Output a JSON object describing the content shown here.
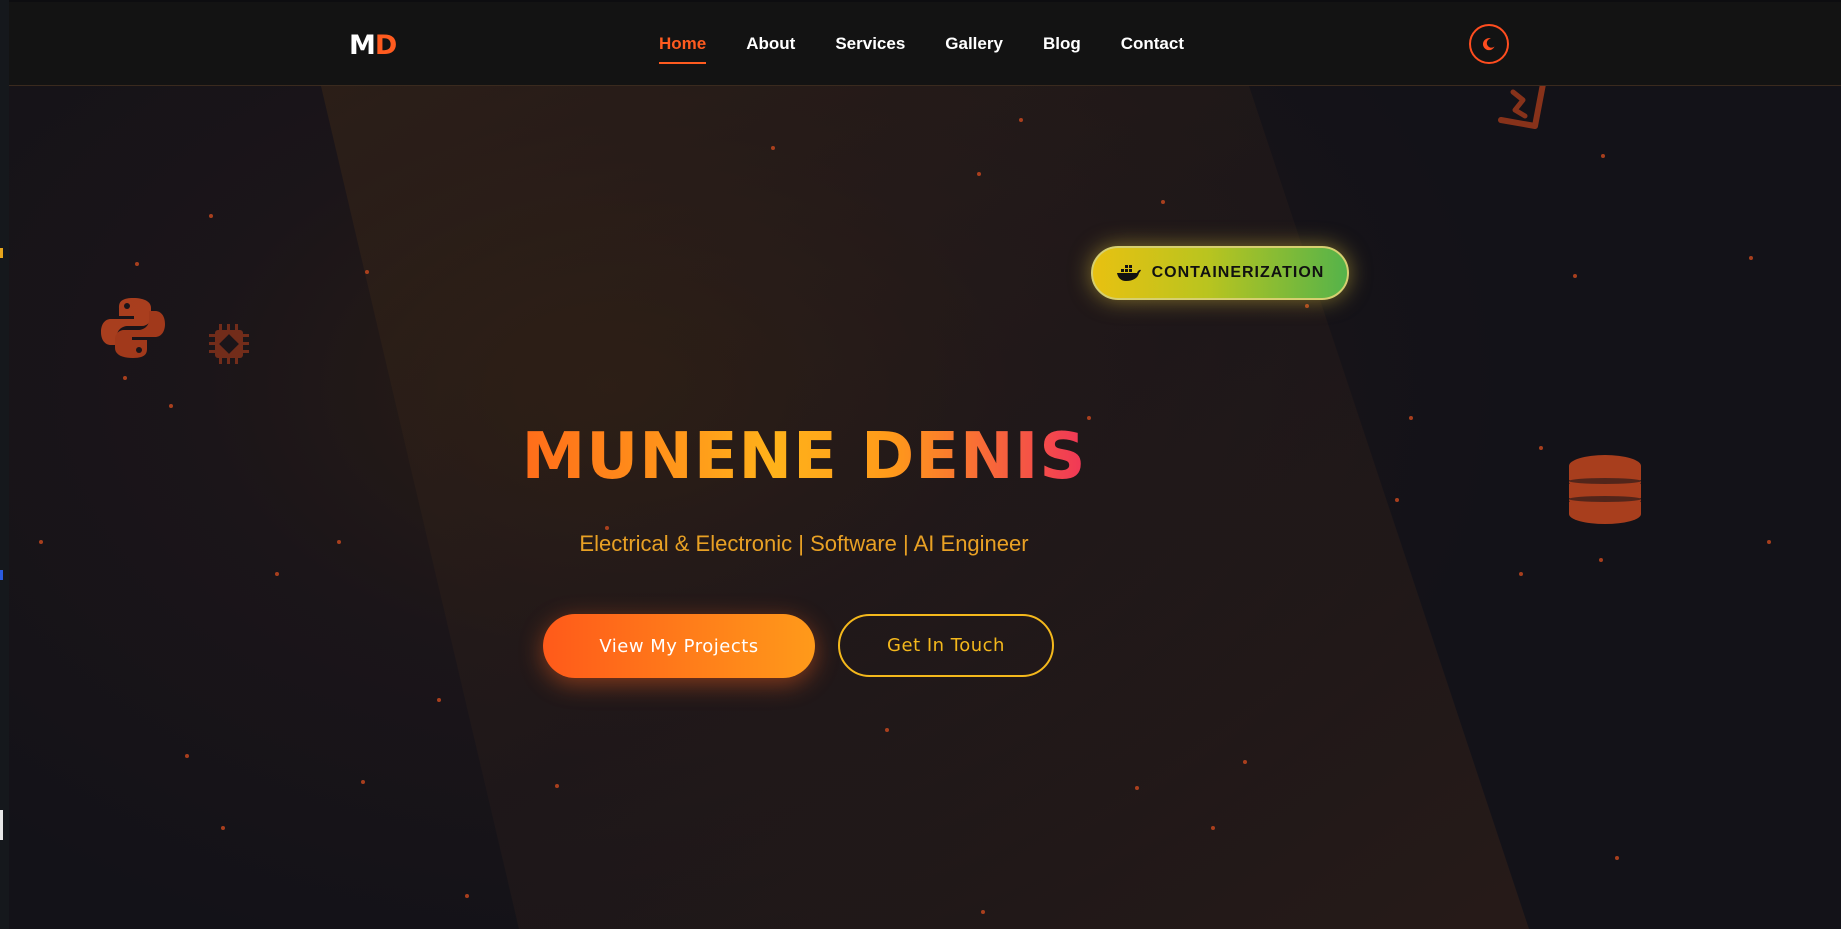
{
  "brand": {
    "logo_main": "M",
    "logo_accent": "D",
    "accent_color": "#ff5b1f"
  },
  "nav": {
    "items": [
      {
        "label": "Home",
        "active": true
      },
      {
        "label": "About",
        "active": false
      },
      {
        "label": "Services",
        "active": false
      },
      {
        "label": "Gallery",
        "active": false
      },
      {
        "label": "Blog",
        "active": false
      },
      {
        "label": "Contact",
        "active": false
      }
    ],
    "theme_toggle_icon": "moon-icon"
  },
  "hero": {
    "title": "MUNENE DENIS",
    "subtitle": "Electrical & Electronic | Software | AI Engineer",
    "primary_button": "View My Projects",
    "secondary_button": "Get In Touch",
    "badge": {
      "label": "CONTAINERIZATION",
      "icon": "docker-whale-icon"
    },
    "floating_icons": [
      "python-icon",
      "cpu-chip-icon",
      "database-icon",
      "java-cup-icon"
    ]
  },
  "colors": {
    "primary_gradient": [
      "#ff5a1a",
      "#ff9a1a"
    ],
    "secondary_border": "#f4b81c",
    "title_gradient": [
      "#ff6a1a",
      "#ffb21a",
      "#f0325a"
    ],
    "subtitle": "#e9a124",
    "badge_gradient": [
      "#e8c111",
      "#55b34a"
    ],
    "particle": "#c2461f"
  }
}
